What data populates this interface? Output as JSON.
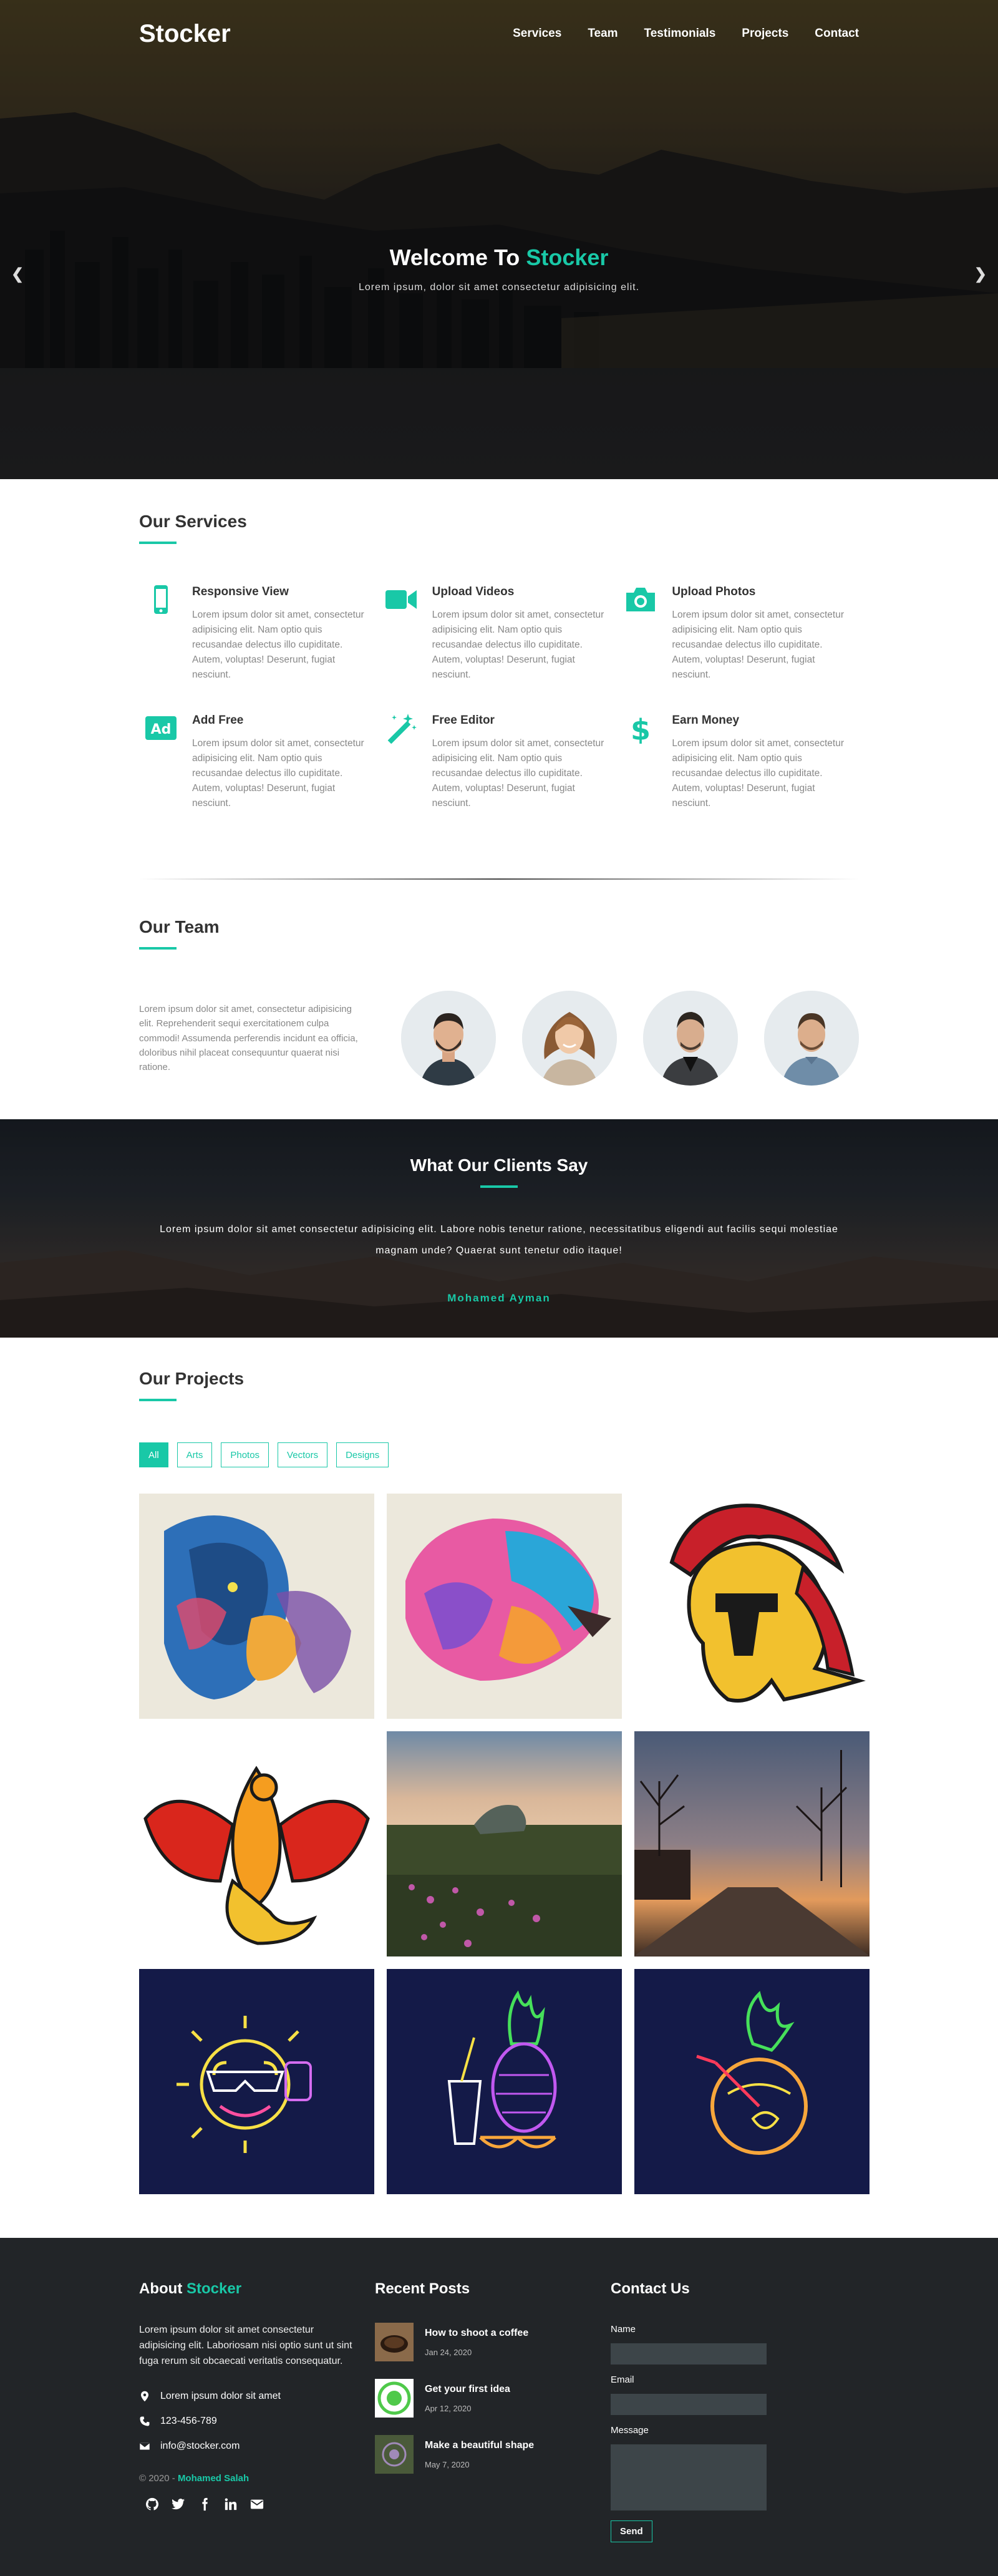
{
  "brand": {
    "name": "Stocker",
    "accent_color": "#19c8a7"
  },
  "nav": {
    "items": [
      "Services",
      "Team",
      "Testimonials",
      "Projects",
      "Contact"
    ]
  },
  "hero": {
    "title_prefix": "Welcome To",
    "title_accent": "Stocker",
    "subtitle": "Lorem ipsum, dolor sit amet consectetur adipisicing elit.",
    "prev_icon": "chevron-left-icon",
    "next_icon": "chevron-right-icon"
  },
  "services": {
    "title": "Our Services",
    "items": [
      {
        "icon": "mobile-icon",
        "title": "Responsive View",
        "text": "Lorem ipsum dolor sit amet, consectetur adipisicing elit. Nam optio quis recusandae delectus illo cupiditate. Autem, voluptas! Deserunt, fugiat nesciunt."
      },
      {
        "icon": "video-icon",
        "title": "Upload Videos",
        "text": "Lorem ipsum dolor sit amet, consectetur adipisicing elit. Nam optio quis recusandae delectus illo cupiditate. Autem, voluptas! Deserunt, fugiat nesciunt."
      },
      {
        "icon": "camera-icon",
        "title": "Upload Photos",
        "text": "Lorem ipsum dolor sit amet, consectetur adipisicing elit. Nam optio quis recusandae delectus illo cupiditate. Autem, voluptas! Deserunt, fugiat nesciunt."
      },
      {
        "icon": "ad-icon",
        "title": "Add Free",
        "text": "Lorem ipsum dolor sit amet, consectetur adipisicing elit. Nam optio quis recusandae delectus illo cupiditate. Autem, voluptas! Deserunt, fugiat nesciunt."
      },
      {
        "icon": "magic-wand-icon",
        "title": "Free Editor",
        "text": "Lorem ipsum dolor sit amet, consectetur adipisicing elit. Nam optio quis recusandae delectus illo cupiditate. Autem, voluptas! Deserunt, fugiat nesciunt."
      },
      {
        "icon": "dollar-icon",
        "title": "Earn Money",
        "text": "Lorem ipsum dolor sit amet, consectetur adipisicing elit. Nam optio quis recusandae delectus illo cupiditate. Autem, voluptas! Deserunt, fugiat nesciunt."
      }
    ]
  },
  "team": {
    "title": "Our Team",
    "text": "Lorem ipsum dolor sit amet, consectetur adipisicing elit. Reprehenderit sequi exercitationem culpa commodi! Assumenda perferendis incidunt ea officia, doloribus nihil placeat consequuntur quaerat nisi ratione."
  },
  "testimonials": {
    "title": "What Our Clients Say",
    "quote": "Lorem ipsum dolor sit amet consectetur adipisicing elit. Labore nobis tenetur ratione, necessitatibus eligendi aut facilis sequi molestiae magnam unde? Quaerat sunt tenetur odio itaque!",
    "author": "Mohamed Ayman"
  },
  "projects": {
    "title": "Our Projects",
    "filters": [
      "All",
      "Arts",
      "Photos",
      "Vectors",
      "Designs"
    ],
    "active_filter": "All"
  },
  "footer": {
    "about": {
      "title_prefix": "About",
      "title_accent": "Stocker",
      "text": "Lorem ipsum dolor sit amet consectetur adipisicing elit. Laboriosam nisi optio sunt ut sint fuga rerum sit obcaecati veritatis consequatur.",
      "address": "Lorem ipsum dolor sit amet",
      "phone": "123-456-789",
      "email": "info@stocker.com",
      "copy_prefix": "© 2020 -",
      "copy_name": "Mohamed Salah"
    },
    "posts": {
      "title": "Recent Posts",
      "items": [
        {
          "title": "How to shoot a coffee",
          "date": "Jan 24, 2020"
        },
        {
          "title": "Get your first idea",
          "date": "Apr 12, 2020"
        },
        {
          "title": "Make a beautiful shape",
          "date": "May 7, 2020"
        }
      ]
    },
    "contact": {
      "title": "Contact Us",
      "name_label": "Name",
      "email_label": "Email",
      "message_label": "Message",
      "send_label": "Send"
    }
  }
}
